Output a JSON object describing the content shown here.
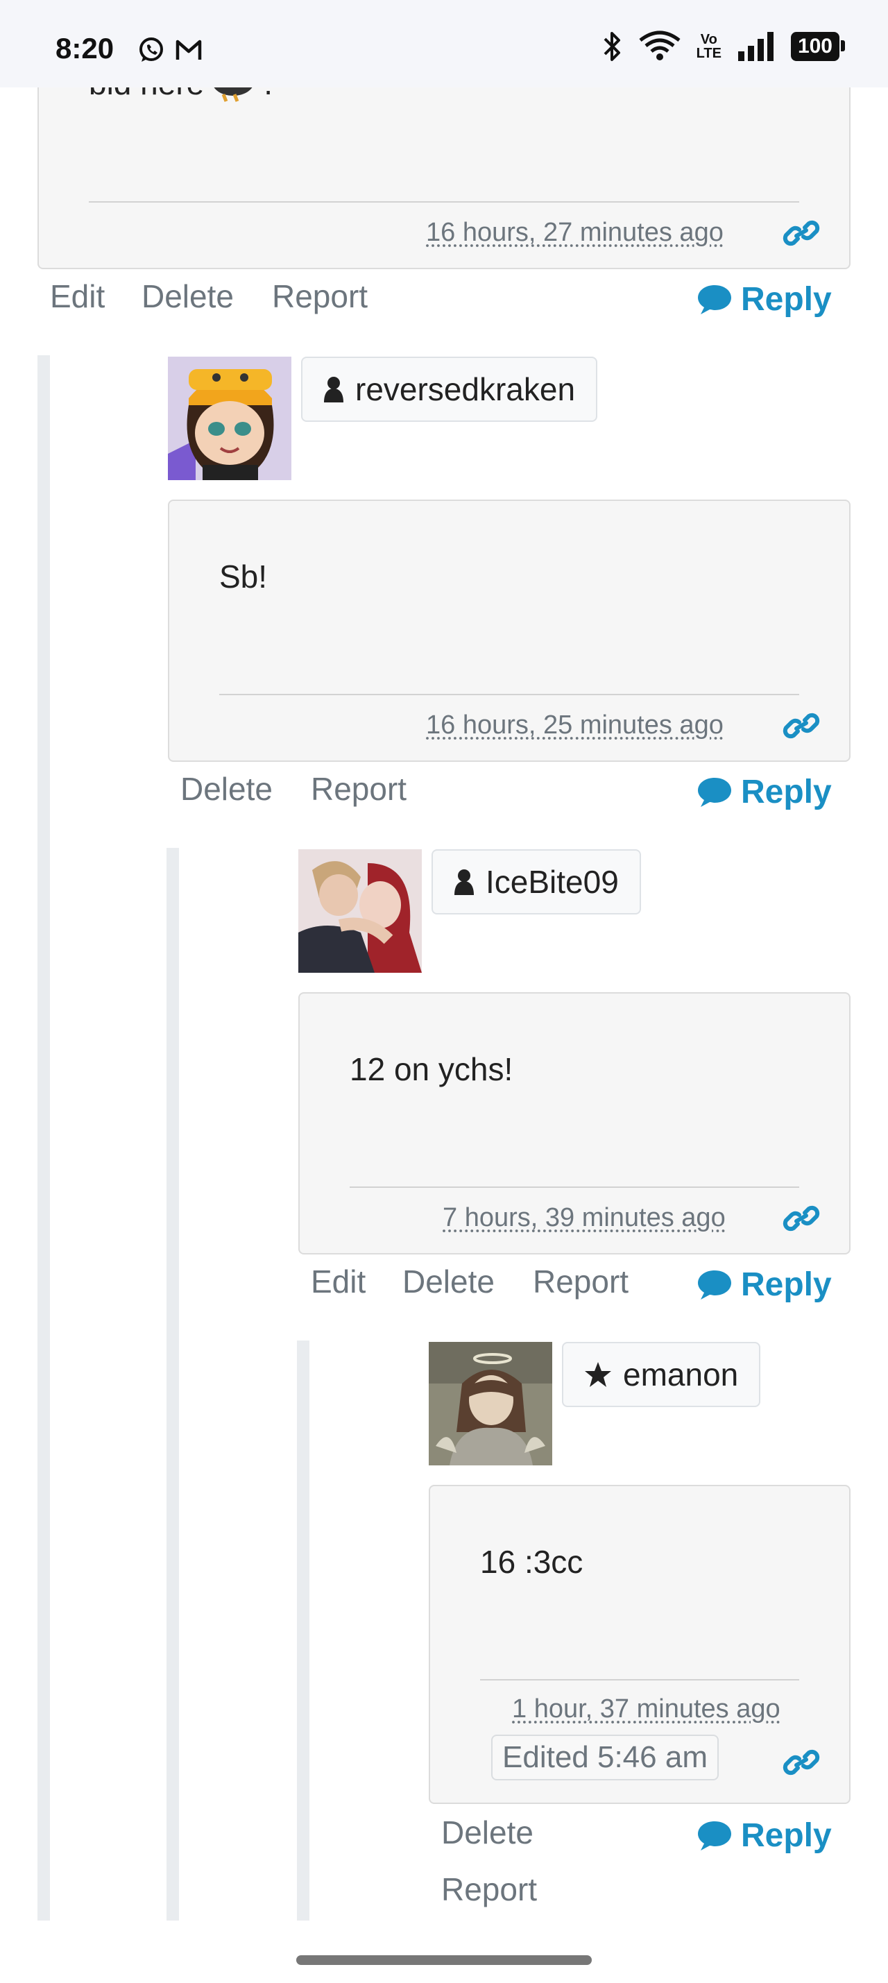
{
  "status_bar": {
    "time": "8:20",
    "left_icons": [
      "whatsapp-icon",
      "gmail-icon"
    ],
    "right_icons": [
      "bluetooth-icon",
      "wifi-icon",
      "volte-icon",
      "signal-icon"
    ],
    "volte_label_top": "Vo",
    "volte_label_bottom": "LTE",
    "battery": "100"
  },
  "colors": {
    "accent": "#1a8fc4",
    "muted_text": "#6c757d",
    "card_bg": "#f6f6f6",
    "rail": "#e9ecef"
  },
  "comments": [
    {
      "id": "c0",
      "body": "bid here",
      "body_suffix": ".",
      "timestamp": "16 hours, 27 minutes ago",
      "actions": [
        "Edit",
        "Delete",
        "Report"
      ],
      "reply_label": "Reply"
    },
    {
      "id": "c1",
      "username": "reversedkraken",
      "user_icon": "user-icon",
      "body": "Sb!",
      "timestamp": "16 hours, 25 minutes ago",
      "actions": [
        "Delete",
        "Report"
      ],
      "reply_label": "Reply"
    },
    {
      "id": "c2",
      "username": "IceBite09",
      "user_icon": "user-icon",
      "body": "12 on ychs!",
      "timestamp": "7 hours, 39 minutes ago",
      "actions": [
        "Edit",
        "Delete",
        "Report"
      ],
      "reply_label": "Reply"
    },
    {
      "id": "c3",
      "username": "emanon",
      "user_icon": "star-icon",
      "body": "16 :3cc",
      "timestamp": "1 hour, 37 minutes ago",
      "edited": "Edited 5:46 am",
      "actions": [
        "Delete",
        "Report"
      ],
      "reply_label": "Reply"
    }
  ]
}
